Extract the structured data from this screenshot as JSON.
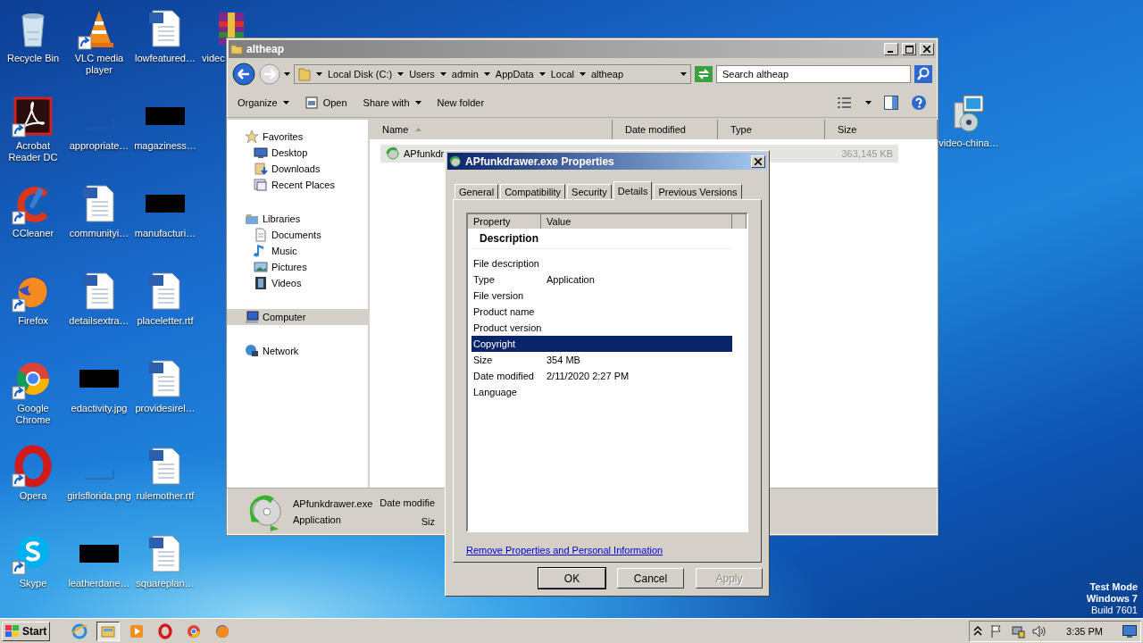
{
  "desktop": {
    "icons": [
      {
        "label": "Recycle Bin",
        "kind": "recycle",
        "shortcut": false
      },
      {
        "label": "Acrobat Reader DC",
        "kind": "acrobat",
        "shortcut": true
      },
      {
        "label": "CCleaner",
        "kind": "ccleaner",
        "shortcut": true
      },
      {
        "label": "Firefox",
        "kind": "firefox",
        "shortcut": true
      },
      {
        "label": "Google Chrome",
        "kind": "chrome",
        "shortcut": true
      },
      {
        "label": "Opera",
        "kind": "opera",
        "shortcut": true
      },
      {
        "label": "Skype",
        "kind": "skype",
        "shortcut": true
      },
      {
        "label": "VLC media player",
        "kind": "vlc",
        "shortcut": true
      },
      {
        "label": "appropriate…",
        "kind": "blank",
        "shortcut": false
      },
      {
        "label": "communityi…",
        "kind": "word",
        "shortcut": false
      },
      {
        "label": "detailsextra…",
        "kind": "word",
        "shortcut": false
      },
      {
        "label": "edactivity.jpg",
        "kind": "black",
        "shortcut": false
      },
      {
        "label": "girlsflorida.png",
        "kind": "blank",
        "shortcut": false
      },
      {
        "label": "leatherdane…",
        "kind": "black",
        "shortcut": false
      },
      {
        "label": "lowfeatured…",
        "kind": "word",
        "shortcut": false
      },
      {
        "label": "magaziness…",
        "kind": "black",
        "shortcut": false
      },
      {
        "label": "manufacturi…",
        "kind": "black",
        "shortcut": false
      },
      {
        "label": "placeletter.rtf",
        "kind": "word",
        "shortcut": false
      },
      {
        "label": "providesirel…",
        "kind": "word",
        "shortcut": false
      },
      {
        "label": "rulemother.rtf",
        "kind": "word",
        "shortcut": false
      },
      {
        "label": "squareplan…",
        "kind": "word",
        "shortcut": false
      },
      {
        "label": "videc",
        "kind": "archive",
        "shortcut": false
      }
    ],
    "right_icons": [
      {
        "label": "video-china…",
        "kind": "installer",
        "shortcut": false
      }
    ],
    "os_watermark": [
      "Test Mode",
      "Windows 7",
      "Build 7601"
    ]
  },
  "explorer": {
    "title": "altheap",
    "breadcrumb": [
      "Local Disk (C:)",
      "Users",
      "admin",
      "AppData",
      "Local",
      "altheap"
    ],
    "search": {
      "placeholder": "Search altheap"
    },
    "toolbar": [
      {
        "label": "Organize",
        "kind": "menu"
      },
      {
        "label": "Open",
        "kind": "open"
      },
      {
        "label": "Share with",
        "kind": "menu"
      },
      {
        "label": "New folder",
        "kind": "plain"
      }
    ],
    "nav": [
      {
        "label": "Favorites",
        "kind": "star",
        "selected": false,
        "children": [
          {
            "label": "Desktop",
            "kind": "desktop",
            "selected": false
          },
          {
            "label": "Downloads",
            "kind": "downloads",
            "selected": false
          },
          {
            "label": "Recent Places",
            "kind": "recent",
            "selected": false
          }
        ]
      },
      {
        "label": "Libraries",
        "kind": "library",
        "selected": false,
        "children": [
          {
            "label": "Documents",
            "kind": "document",
            "selected": false
          },
          {
            "label": "Music",
            "kind": "music",
            "selected": false
          },
          {
            "label": "Pictures",
            "kind": "pictures",
            "selected": false
          },
          {
            "label": "Videos",
            "kind": "videos",
            "selected": false
          }
        ]
      },
      {
        "label": "Computer",
        "kind": "computer",
        "selected": true
      },
      {
        "label": "Network",
        "kind": "network",
        "selected": false
      }
    ],
    "table": {
      "columns": [
        "Name",
        "Date modified",
        "Type",
        "Size"
      ],
      "rows": [
        {
          "name": "APfunkdr",
          "size": "363,145 KB",
          "selected": true
        }
      ]
    },
    "details_pane": {
      "name": "APfunkdrawer.exe",
      "type": "Application",
      "label_1": "Date modifie",
      "label_2": "Siz"
    }
  },
  "dialog": {
    "title": "APfunkdrawer.exe Properties",
    "tabs": [
      {
        "label": "General",
        "selected": false
      },
      {
        "label": "Compatibility",
        "selected": false
      },
      {
        "label": "Security",
        "selected": false
      },
      {
        "label": "Details",
        "selected": true
      },
      {
        "label": "Previous Versions",
        "selected": false
      }
    ],
    "columns": [
      "Property",
      "Value"
    ],
    "rows": [
      {
        "kind": "header",
        "property": "Description"
      },
      {
        "kind": "row",
        "property": "File description",
        "selected": false
      },
      {
        "kind": "row",
        "property": "Type",
        "value": "Application",
        "selected": false
      },
      {
        "kind": "row",
        "property": "File version",
        "selected": false
      },
      {
        "kind": "row",
        "property": "Product name",
        "selected": false
      },
      {
        "kind": "row",
        "property": "Product version",
        "selected": false
      },
      {
        "kind": "row",
        "property": "Copyright",
        "selected": true
      },
      {
        "kind": "row",
        "property": "Size",
        "value": "354 MB",
        "selected": false
      },
      {
        "kind": "row",
        "property": "Date modified",
        "value": "2/11/2020 2:27 PM",
        "selected": false
      },
      {
        "kind": "row",
        "property": "Language",
        "selected": false
      }
    ],
    "link": "Remove Properties and Personal Information",
    "buttons": [
      {
        "label": "OK",
        "default": true,
        "disabled": false
      },
      {
        "label": "Cancel",
        "default": false,
        "disabled": false
      },
      {
        "label": "Apply",
        "default": false,
        "disabled": true
      }
    ]
  },
  "taskbar": {
    "start": "Start",
    "apps": [
      {
        "kind": "ie",
        "selected": false
      },
      {
        "kind": "explorer",
        "selected": true
      },
      {
        "kind": "media",
        "selected": false
      },
      {
        "kind": "opera",
        "selected": false
      },
      {
        "kind": "chrome",
        "selected": false
      },
      {
        "kind": "firefox",
        "selected": false
      }
    ],
    "clock": "3:35 PM"
  }
}
